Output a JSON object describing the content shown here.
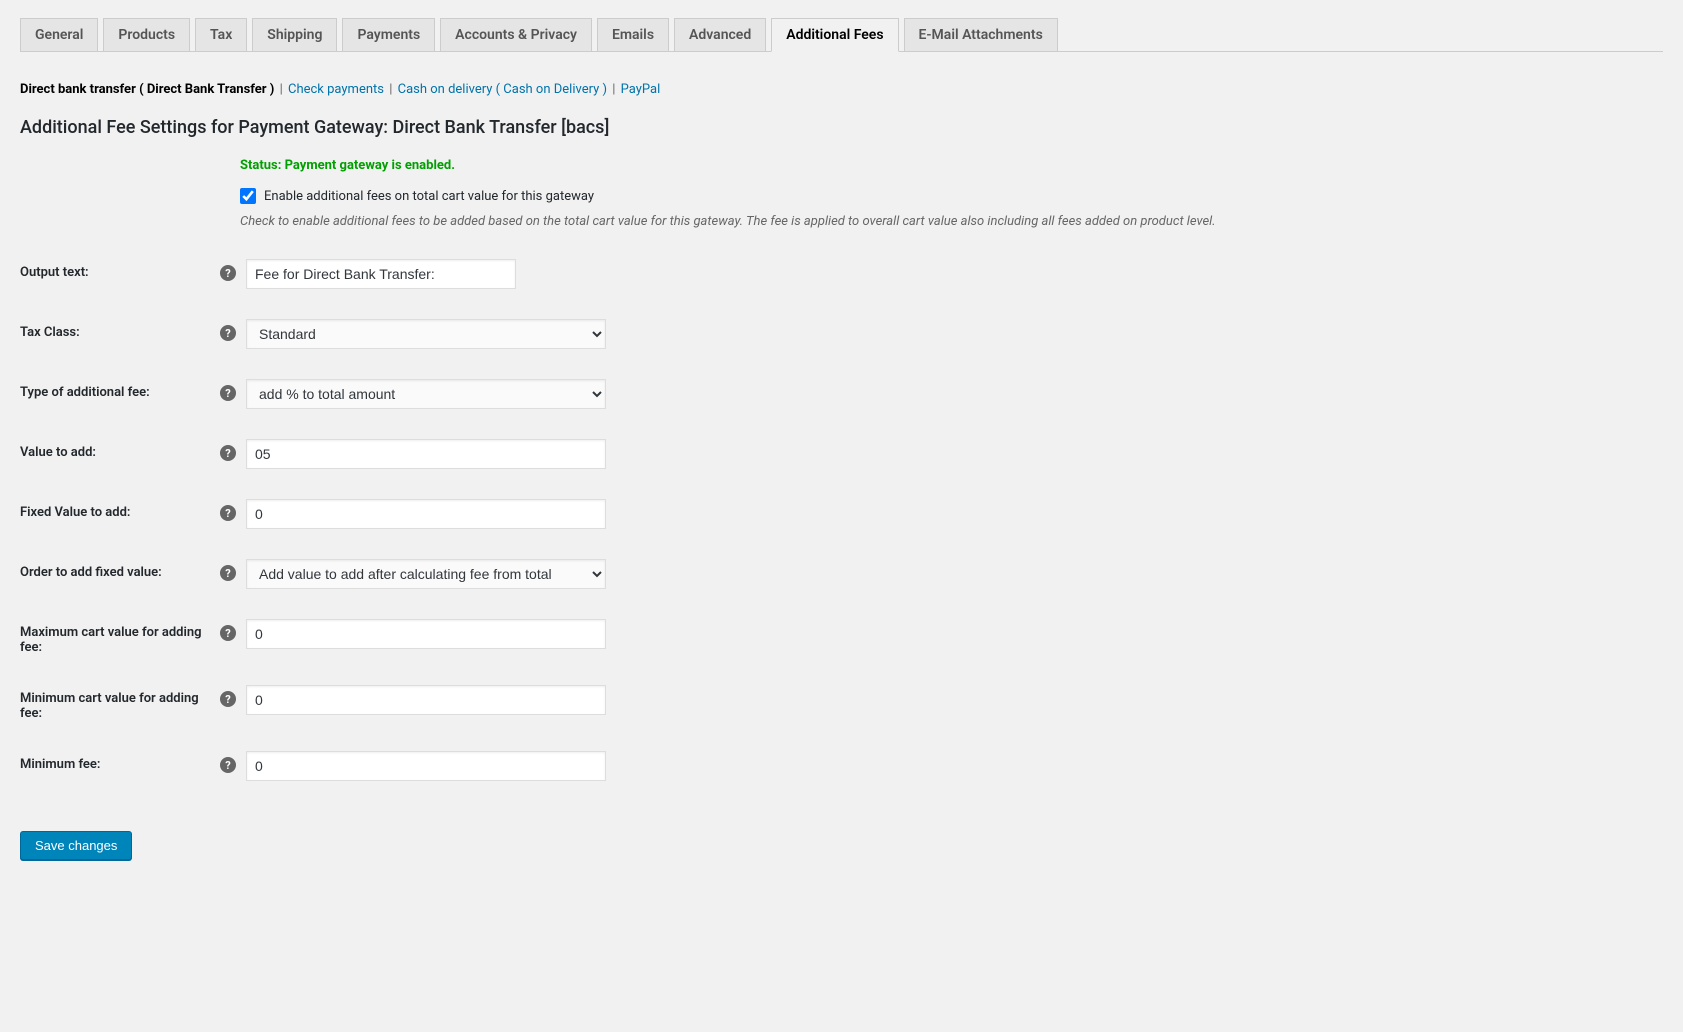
{
  "tabs": {
    "general": "General",
    "products": "Products",
    "tax": "Tax",
    "shipping": "Shipping",
    "payments": "Payments",
    "accounts": "Accounts & Privacy",
    "emails": "Emails",
    "advanced": "Advanced",
    "additional_fees": "Additional Fees",
    "email_attachments": "E-Mail Attachments"
  },
  "subnav": {
    "active": "Direct bank transfer ( Direct Bank Transfer )",
    "check": "Check payments",
    "cod": "Cash on delivery ( Cash on Delivery )",
    "paypal": "PayPal"
  },
  "heading": "Additional Fee Settings for Payment Gateway: Direct Bank Transfer [bacs]",
  "status": "Status: Payment gateway is enabled.",
  "enable_checkbox_label": "Enable additional fees on total cart value for this gateway",
  "description": "Check to enable additional fees to be added based on the total cart value for this gateway. The fee is applied to overall cart value also including all fees added on product level.",
  "fields": {
    "output_text": {
      "label": "Output text:",
      "value": "Fee for Direct Bank Transfer:"
    },
    "tax_class": {
      "label": "Tax Class:",
      "value": "Standard"
    },
    "fee_type": {
      "label": "Type of additional fee:",
      "value": "add % to total amount"
    },
    "value_to_add": {
      "label": "Value to add:",
      "value": "05"
    },
    "fixed_value": {
      "label": "Fixed Value to add:",
      "value": "0"
    },
    "order_fixed": {
      "label": "Order to add fixed value:",
      "value": "Add value to add after calculating fee from total"
    },
    "max_cart": {
      "label": "Maximum cart value for adding fee:",
      "value": "0"
    },
    "min_cart": {
      "label": "Minimum cart value for adding fee:",
      "value": "0"
    },
    "min_fee": {
      "label": "Minimum fee:",
      "value": "0"
    }
  },
  "save_button": "Save changes"
}
